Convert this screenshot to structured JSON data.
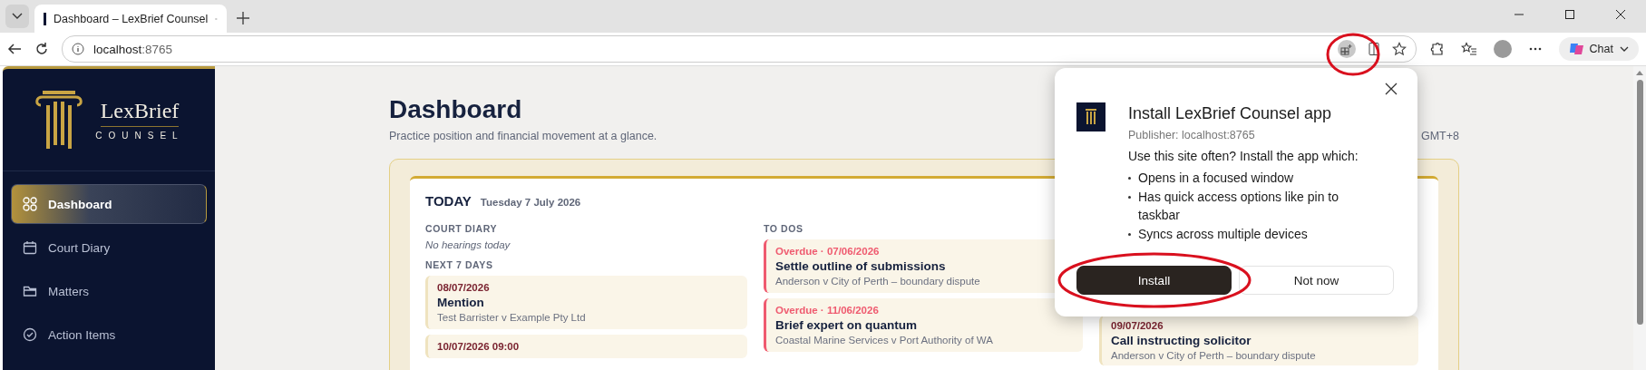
{
  "browser": {
    "tabs": [
      {
        "title": "Dashboard – LexBrief Counsel",
        "selected": true
      }
    ],
    "address": {
      "host": "localhost",
      "port": ":8765"
    },
    "install_app_icon": {
      "circled": true
    },
    "chat_label": "Chat"
  },
  "sidebar": {
    "brand": {
      "name": "LexBrief",
      "tagline": "COUNSEL"
    },
    "items": [
      {
        "label": "Dashboard",
        "kind": "grid",
        "selected": true
      },
      {
        "label": "Court Diary",
        "kind": "calendar",
        "selected": false
      },
      {
        "label": "Matters",
        "kind": "folder",
        "selected": false
      },
      {
        "label": "Action Items",
        "kind": "check",
        "selected": false
      }
    ]
  },
  "page": {
    "title": "Dashboard",
    "subtitle": "Practice position and financial movement at a glance.",
    "header_info": "GMT+8"
  },
  "today": {
    "heading": "TODAY",
    "date": "Tuesday 7 July 2026",
    "court_diary": {
      "heading": "COURT DIARY",
      "empty": "No hearings today",
      "next_heading": "NEXT 7 DAYS",
      "items": [
        {
          "date": "08/07/2026",
          "title": "Mention",
          "matter": "Test Barrister v Example Pty Ltd"
        },
        {
          "date": "10/07/2026 09:00"
        }
      ]
    },
    "todos": {
      "heading": "TO DOS",
      "items": [
        {
          "kind": "overdue",
          "due": "Overdue · 07/06/2026",
          "title": "Settle outline of submissions",
          "matter": "Anderson v City of Perth – boundary dispute"
        },
        {
          "kind": "overdue",
          "due": "Overdue · 11/06/2026",
          "title": "Brief expert on quantum",
          "matter": "Coastal Marine Services v Port Authority of WA"
        }
      ]
    },
    "column_3": {
      "items": [
        {
          "date": "09/07/2026",
          "title": "Call instructing solicitor",
          "matter": "Anderson v City of Perth – boundary dispute"
        }
      ]
    }
  },
  "install_popup": {
    "title": "Install LexBrief Counsel app",
    "publisher": "Publisher: localhost:8765",
    "intro": "Use this site often? Install the app which:",
    "bullets": [
      "Opens in a focused window",
      "Has quick access options like pin to taskbar",
      "Syncs across multiple devices"
    ],
    "buttons": [
      {
        "label": "Install",
        "kind": "primary",
        "circled": true
      },
      {
        "label": "Not now",
        "kind": "secondary",
        "circled": false
      }
    ]
  }
}
